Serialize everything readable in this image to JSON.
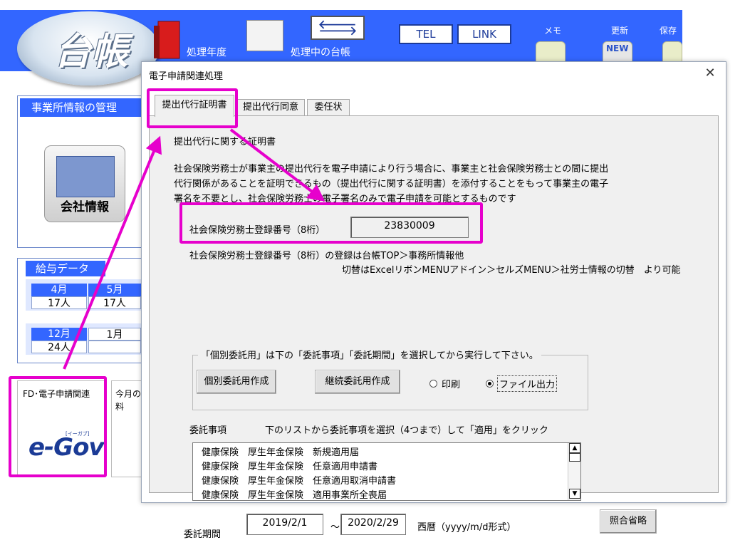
{
  "toolbar": {
    "logo": "台帳",
    "year_label": "処理年度",
    "current_ledger_label": "処理中の台帳",
    "tel_label": "TEL",
    "link_label": "LINK",
    "memo_label": "メモ",
    "update_label": "更新",
    "save_label": "保存",
    "new_badge": "NEW"
  },
  "sidebar": {
    "office_header": "事業所情報の管理",
    "company_label": "会社情報",
    "salary_header": "給与データ",
    "months_row1": [
      {
        "month": "4月",
        "count": "17人"
      },
      {
        "month": "5月",
        "count": "17人"
      }
    ],
    "months_row2": [
      {
        "month": "12月",
        "count": "24人"
      },
      {
        "month": "1月",
        "count": ""
      }
    ],
    "fd_label": "FD･電子申請関連",
    "egov_logo": "e-Gov",
    "egov_sub": "[イーガブ]",
    "monthly_label": "今月の料"
  },
  "dialog": {
    "title": "電子申請関連処理",
    "close": "✕",
    "tabs": [
      "提出代行証明書",
      "提出代行同意書",
      "委任状"
    ],
    "heading": "提出代行に関する証明書",
    "description": [
      "社会保険労務士が事業主の提出代行を電子申請により行う場合に、事業主と社会保険労務士との間に提出",
      "代行関係があることを証明できるもの（提出代行に関する証明書）を添付することをもって事業主の電子",
      "署名を不要とし、社会保険労務士の電子署名のみで電子申請を可能とするものです"
    ],
    "reg_label": "社会保険労務士登録番号（8桁）",
    "reg_value": "23830009",
    "reg_note1": "社会保険労務士登録番号（8桁）の登録は台帳TOP＞事務所情報他",
    "reg_note2": "切替はExcelリボンMENUアドイン＞セルズMENU＞社労士情報の切替　より可能",
    "group_legend": "「個別委託用」は下の「委託事項」「委託期間」を選択してから実行して下さい。",
    "btn_individual": "個別委託用作成",
    "btn_continuous": "継続委託用作成",
    "radio_print": "印刷",
    "radio_file": "ファイル出力",
    "selected_output": "ファイル出力",
    "items_label": "委託事項",
    "items_instruction": "下のリストから委託事項を選択（4つまで）して「適用」をクリック",
    "items": [
      "健康保険　厚生年金保険　新規適用届",
      "健康保険　厚生年金保険　任意適用申請書",
      "健康保険　厚生年金保険　任意適用取消申請書",
      "健康保険　厚生年金保険　適用事業所全喪届"
    ],
    "period_label": "委託期間",
    "period_start": "2019/2/1",
    "period_sep": "～",
    "period_end": "2020/2/29",
    "period_format": "西暦（yyyy/m/d形式）",
    "btn_skip": "照合省略"
  },
  "colors": {
    "toolbar_blue": "#3366ff",
    "highlight": "#e600cc"
  }
}
